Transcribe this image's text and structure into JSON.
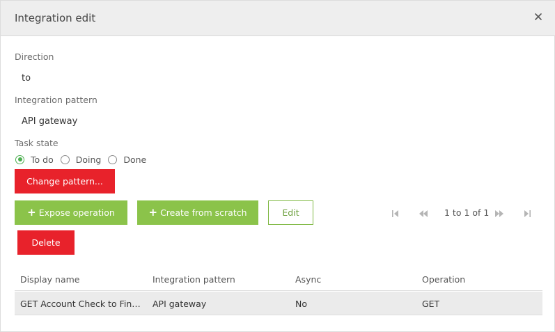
{
  "dialog": {
    "title": "Integration edit",
    "close_icon": "close-icon"
  },
  "form": {
    "direction_label": "Direction",
    "direction_value": "to",
    "pattern_label": "Integration pattern",
    "pattern_value": "API gateway",
    "task_state_label": "Task state",
    "task_state_options": [
      {
        "label": "To do",
        "checked": true
      },
      {
        "label": "Doing",
        "checked": false
      },
      {
        "label": "Done",
        "checked": false
      }
    ]
  },
  "buttons": {
    "change_pattern": "Change pattern...",
    "expose_operation": "Expose operation",
    "create_from_scratch": "Create from scratch",
    "edit": "Edit",
    "delete": "Delete"
  },
  "pager": {
    "text": "1 to 1 of 1",
    "icons": [
      "first-page-icon",
      "previous-page-icon",
      "next-page-icon",
      "last-page-icon"
    ]
  },
  "table": {
    "columns": [
      "Display name",
      "Integration pattern",
      "Async",
      "Operation"
    ],
    "rows": [
      [
        "GET Account Check to Fina...",
        "API gateway",
        "No",
        "GET"
      ]
    ]
  },
  "colors": {
    "red": "#e8222b",
    "green": "#8bc34a",
    "radio_green": "#4caf50"
  }
}
